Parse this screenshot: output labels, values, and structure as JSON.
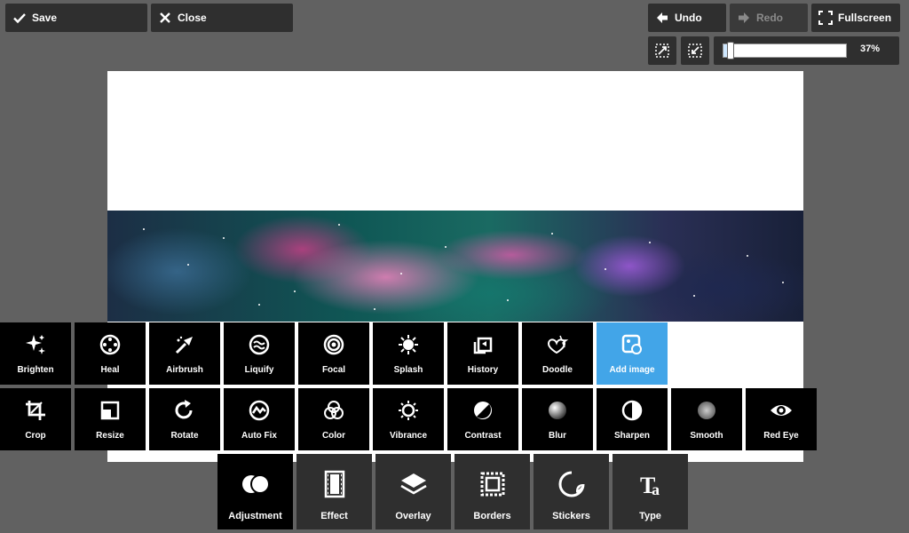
{
  "topbar": {
    "save_label": "Save",
    "close_label": "Close",
    "undo_label": "Undo",
    "redo_label": "Redo",
    "fullscreen_label": "Fullscreen"
  },
  "zoom": {
    "value_label": "37%",
    "fraction": 0.037
  },
  "tools_row1": [
    {
      "label": "Brighten",
      "icon": "sparkles-icon"
    },
    {
      "label": "Heal",
      "icon": "heal-icon"
    },
    {
      "label": "Airbrush",
      "icon": "airbrush-icon"
    },
    {
      "label": "Liquify",
      "icon": "liquify-icon"
    },
    {
      "label": "Focal",
      "icon": "focal-icon"
    },
    {
      "label": "Splash",
      "icon": "splash-icon"
    },
    {
      "label": "History",
      "icon": "history-icon"
    },
    {
      "label": "Doodle",
      "icon": "doodle-icon"
    },
    {
      "label": "Add image",
      "icon": "add-image-icon",
      "active": true
    }
  ],
  "tools_row2": [
    {
      "label": "Crop",
      "icon": "crop-icon"
    },
    {
      "label": "Resize",
      "icon": "resize-icon"
    },
    {
      "label": "Rotate",
      "icon": "rotate-icon"
    },
    {
      "label": "Auto Fix",
      "icon": "auto-fix-icon"
    },
    {
      "label": "Color",
      "icon": "color-icon"
    },
    {
      "label": "Vibrance",
      "icon": "vibrance-icon"
    },
    {
      "label": "Contrast",
      "icon": "contrast-icon"
    },
    {
      "label": "Blur",
      "icon": "blur-icon"
    },
    {
      "label": "Sharpen",
      "icon": "sharpen-icon"
    },
    {
      "label": "Smooth",
      "icon": "smooth-icon"
    },
    {
      "label": "Red Eye",
      "icon": "eye-icon"
    }
  ],
  "categories": [
    {
      "label": "Adjustment",
      "icon": "adjustment-icon",
      "active": true
    },
    {
      "label": "Effect",
      "icon": "film-icon"
    },
    {
      "label": "Overlay",
      "icon": "layers-icon"
    },
    {
      "label": "Borders",
      "icon": "borders-icon"
    },
    {
      "label": "Stickers",
      "icon": "sticker-icon"
    },
    {
      "label": "Type",
      "icon": "type-icon"
    }
  ],
  "colors": {
    "active": "#42a5e8",
    "panel": "#2f2f2f",
    "background": "#616161"
  }
}
